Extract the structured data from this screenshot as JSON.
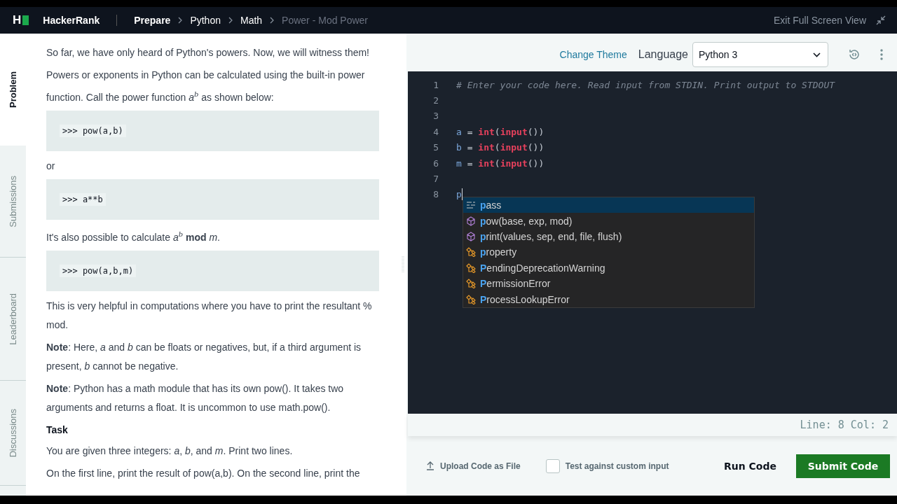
{
  "header": {
    "logo": "H",
    "brand": "HackerRank",
    "breadcrumbs": [
      {
        "label": "Prepare",
        "current": false,
        "bold": true
      },
      {
        "label": "Python",
        "current": false,
        "bold": false
      },
      {
        "label": "Math",
        "current": false,
        "bold": false
      },
      {
        "label": "Power - Mod Power",
        "current": true,
        "bold": false
      }
    ],
    "exit_label": "Exit Full Screen View"
  },
  "side_tabs": [
    {
      "label": "Problem",
      "selected": true
    },
    {
      "label": "Submissions",
      "selected": false
    },
    {
      "label": "Leaderboard",
      "selected": false
    },
    {
      "label": "Discussions",
      "selected": false
    }
  ],
  "problem": [
    {
      "kind": "text",
      "text": "So far, we have only heard of Python's powers. Now, we will witness them!"
    },
    {
      "kind": "text",
      "text": "Powers or exponents in Python can be calculated using the built-in power function. Call the power function *a*$^{b}$ as shown below:"
    },
    {
      "kind": "code",
      "text": ">>> pow(a,b)"
    },
    {
      "kind": "text",
      "text": "or"
    },
    {
      "kind": "code",
      "text": ">>> a**b"
    },
    {
      "kind": "text",
      "text": "It's also possible to calculate *a*$^{b}$ **mod** *m*."
    },
    {
      "kind": "code",
      "text": ">>> pow(a,b,m)"
    },
    {
      "kind": "text",
      "text": "This is very helpful in computations where you have to print the resultant % mod."
    },
    {
      "kind": "text",
      "text": "**Note**: Here, *a* and *b* can be floats or negatives, but, if a third argument is present, *b* cannot be negative."
    },
    {
      "kind": "text",
      "text": "**Note**: Python has a math module that has its own pow(). It takes two arguments and returns a float. It is uncommon to use math.pow()."
    },
    {
      "kind": "heading",
      "text": "Task"
    },
    {
      "kind": "text",
      "text": "You are given three integers: *a*, *b*, and *m*. Print two lines."
    },
    {
      "kind": "text",
      "text": "On the first line, print the result of pow(a,b). On the second line, print the"
    }
  ],
  "toolbar": {
    "change_theme": "Change Theme",
    "language_label": "Language",
    "language": "Python 3"
  },
  "editor": {
    "lines": [
      {
        "number": "1",
        "tokens": [
          {
            "kind": "comment",
            "text": "# Enter your code here. Read input from STDIN. Print output to STDOUT"
          }
        ]
      },
      {
        "number": "2"
      },
      {
        "number": "3"
      },
      {
        "number": "4",
        "tokens": [
          {
            "kind": "var",
            "text": "a"
          },
          {
            "kind": "plain",
            "text": " = "
          },
          {
            "kind": "builtin",
            "text": "int"
          },
          {
            "kind": "plain",
            "text": "("
          },
          {
            "kind": "builtin",
            "text": "input"
          },
          {
            "kind": "plain",
            "text": "())"
          }
        ]
      },
      {
        "number": "5",
        "tokens": [
          {
            "kind": "var",
            "text": "b"
          },
          {
            "kind": "plain",
            "text": " = "
          },
          {
            "kind": "builtin",
            "text": "int"
          },
          {
            "kind": "plain",
            "text": "("
          },
          {
            "kind": "builtin",
            "text": "input"
          },
          {
            "kind": "plain",
            "text": "())"
          }
        ]
      },
      {
        "number": "6",
        "tokens": [
          {
            "kind": "var",
            "text": "m"
          },
          {
            "kind": "plain",
            "text": " = "
          },
          {
            "kind": "builtin",
            "text": "int"
          },
          {
            "kind": "plain",
            "text": "("
          },
          {
            "kind": "builtin",
            "text": "input"
          },
          {
            "kind": "plain",
            "text": "())"
          }
        ]
      },
      {
        "number": "7"
      },
      {
        "number": "8",
        "tokens": [
          {
            "kind": "var",
            "text": "p"
          }
        ],
        "cursor": true
      }
    ],
    "suggestions": [
      {
        "kind": "keyword",
        "match": "p",
        "rest": "ass",
        "selected": true
      },
      {
        "kind": "function",
        "match": "p",
        "rest": "ow(base, exp, mod)",
        "selected": false
      },
      {
        "kind": "function",
        "match": "p",
        "rest": "rint(values, sep, end, file, flush)",
        "selected": false
      },
      {
        "kind": "class",
        "match": "p",
        "rest": "roperty",
        "selected": false
      },
      {
        "kind": "class",
        "match": "P",
        "rest": "endingDeprecationWarning",
        "selected": false
      },
      {
        "kind": "class",
        "match": "P",
        "rest": "ermissionError",
        "selected": false
      },
      {
        "kind": "class",
        "match": "P",
        "rest": "rocessLookupError",
        "selected": false
      }
    ],
    "status": "Line: 8 Col: 2"
  },
  "footer": {
    "upload": "Upload Code as File",
    "custom_input": {
      "label": "Test against custom input",
      "checked": false
    },
    "run": "Run Code",
    "submit": "Submit Code"
  }
}
